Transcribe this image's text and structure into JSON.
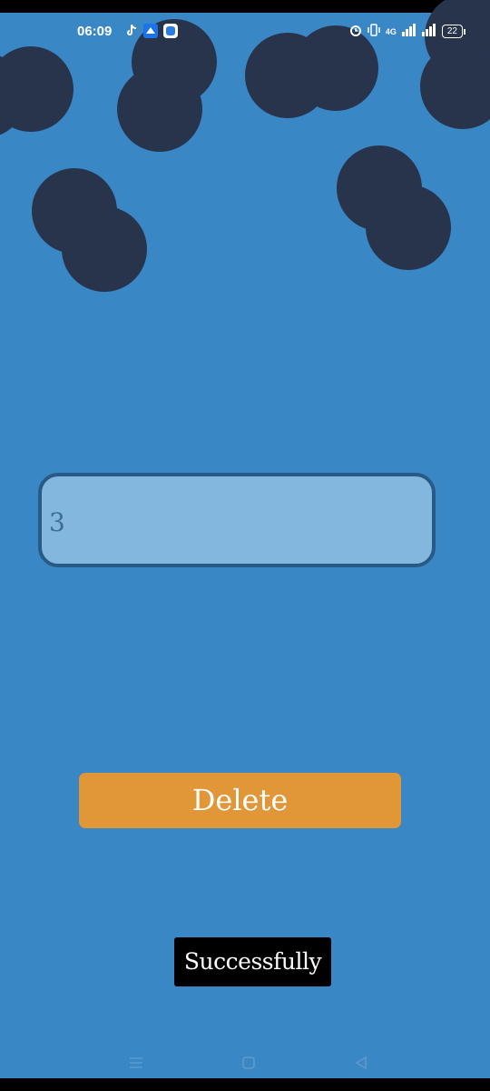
{
  "status_bar": {
    "time": "06:09",
    "network_label": "4G",
    "battery_level": "22"
  },
  "input": {
    "value": "3"
  },
  "delete_button": {
    "label": "Delete"
  },
  "toast": {
    "message": "Successfully"
  },
  "colors": {
    "background": "#3a87c6",
    "bubble": "#27344c",
    "input_fill": "#84b7de",
    "input_border": "#275b86",
    "button": "#e19637",
    "toast": "#000000"
  },
  "icons": {
    "status_left": [
      "tiktok-icon",
      "drive-icon",
      "app-icon"
    ],
    "status_right": [
      "alarm-icon",
      "vibrate-icon",
      "signal-icon",
      "signal-icon-2",
      "battery-icon"
    ],
    "nav": [
      "menu-icon",
      "home-icon",
      "back-icon"
    ]
  }
}
